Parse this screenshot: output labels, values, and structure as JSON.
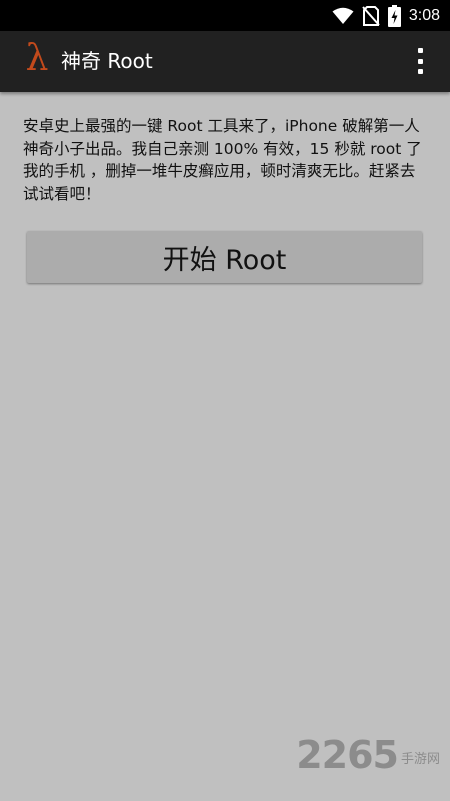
{
  "status_bar": {
    "time": "3:08",
    "icons": [
      "wifi-icon",
      "no-sim-icon",
      "battery-charging-icon"
    ]
  },
  "app_bar": {
    "logo": "λ",
    "title": "神奇 Root",
    "menu_icon": "overflow-menu-icon"
  },
  "main": {
    "description": "安卓史上最强的一键 Root 工具来了，iPhone 破解第一人神奇小子出品。我自己亲测 100% 有效，15 秒就 root 了我的手机 ，删掉一堆牛皮癣应用，顿时清爽无比。赶紧去试试看吧！",
    "start_button_label": "开始 Root"
  },
  "watermark": {
    "number": "2265",
    "text": "手游网"
  },
  "colors": {
    "background": "#c0c0c0",
    "app_bar": "#212121",
    "logo": "#c24a1c",
    "button": "#acacac"
  }
}
